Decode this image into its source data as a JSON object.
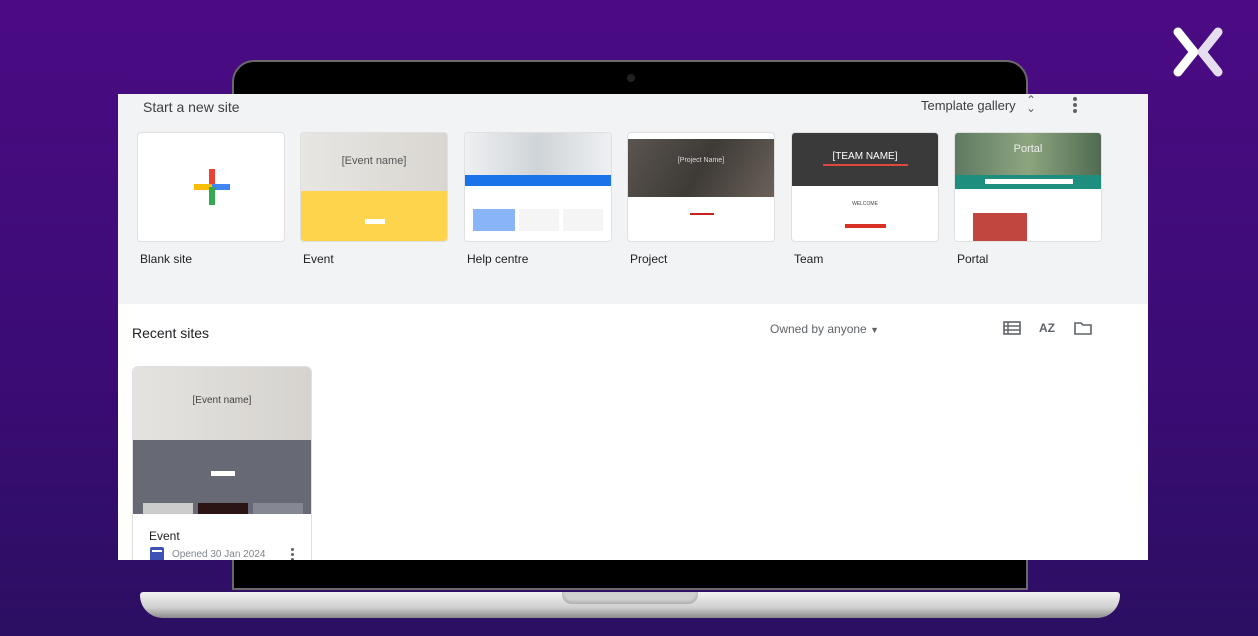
{
  "brand": {
    "logo": "x-logo",
    "accent": "#4b0b84"
  },
  "start": {
    "title": "Start a new site",
    "gallery_label": "Template gallery",
    "templates": [
      {
        "label": "Blank site"
      },
      {
        "label": "Event",
        "thumb_text": "[Event name]"
      },
      {
        "label": "Help centre"
      },
      {
        "label": "Project",
        "thumb_text": "[Project Name]"
      },
      {
        "label": "Team",
        "thumb_text": "[TEAM NAME]",
        "thumb_sub": "WELCOME"
      },
      {
        "label": "Portal",
        "thumb_text": "Portal"
      }
    ]
  },
  "recent": {
    "title": "Recent sites",
    "owner_filter": "Owned by anyone",
    "sites": [
      {
        "name": "Event",
        "opened": "Opened 30 Jan 2024",
        "thumb_text": "[Event name]"
      }
    ]
  },
  "colors": {
    "google_blue": "#4285f4",
    "google_red": "#ea4335",
    "google_yellow": "#fbbc04",
    "google_green": "#34a853",
    "sites_icon": "#3f51b5"
  }
}
